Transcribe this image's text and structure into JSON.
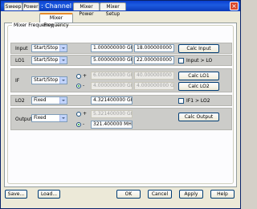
{
  "window": {
    "title": "SMC Setup : Channel 1",
    "close_glyph": "×"
  },
  "tabs": [
    {
      "label": "Sweep"
    },
    {
      "label": "Power"
    },
    {
      "label": "Mixer Frequency",
      "active": true
    },
    {
      "label": "Mixer Power"
    },
    {
      "label": "Mixer Setup"
    }
  ],
  "group": {
    "label": "Mixer Frequency"
  },
  "rows": {
    "input": {
      "label": "Input",
      "mode": "Start/Stop",
      "start": "1.000000000 GHz",
      "stop": "18.000000000 GHz",
      "button": "Calc Input"
    },
    "lo1": {
      "label": "LO1",
      "mode": "Start/Stop",
      "start": "5.000000000 GHz",
      "stop": "22.000000000 GHz",
      "check_label": "Input > LO"
    },
    "if": {
      "label": "IF",
      "mode": "Start/Stop",
      "plus": "+",
      "minus": "-",
      "start": "6.000000000 GHz",
      "stop": "40.000000000 GHz",
      "start2": "4.000000000 GHz",
      "stop2": "4.000000000 GHz",
      "button1": "Calc LO1",
      "button2": "Calc LO2"
    },
    "lo2": {
      "label": "LO2",
      "mode": "Fixed",
      "value": "4.321400000 GHz",
      "check_label": "IF1 > LO2"
    },
    "output": {
      "label": "Output",
      "mode": "Fixed",
      "plus": "+",
      "minus": "-",
      "value1": "5.321400000 GHz",
      "value2": "321.400000 MHz",
      "button": "Calc Output"
    }
  },
  "footer": {
    "save": "Save...",
    "load": "Load...",
    "ok": "OK",
    "cancel": "Cancel",
    "apply": "Apply",
    "help": "Help"
  },
  "colors": {
    "titlebar": "#0a3fd0",
    "tab_accent": "#e68b2c",
    "radio_on": "#21a121"
  }
}
